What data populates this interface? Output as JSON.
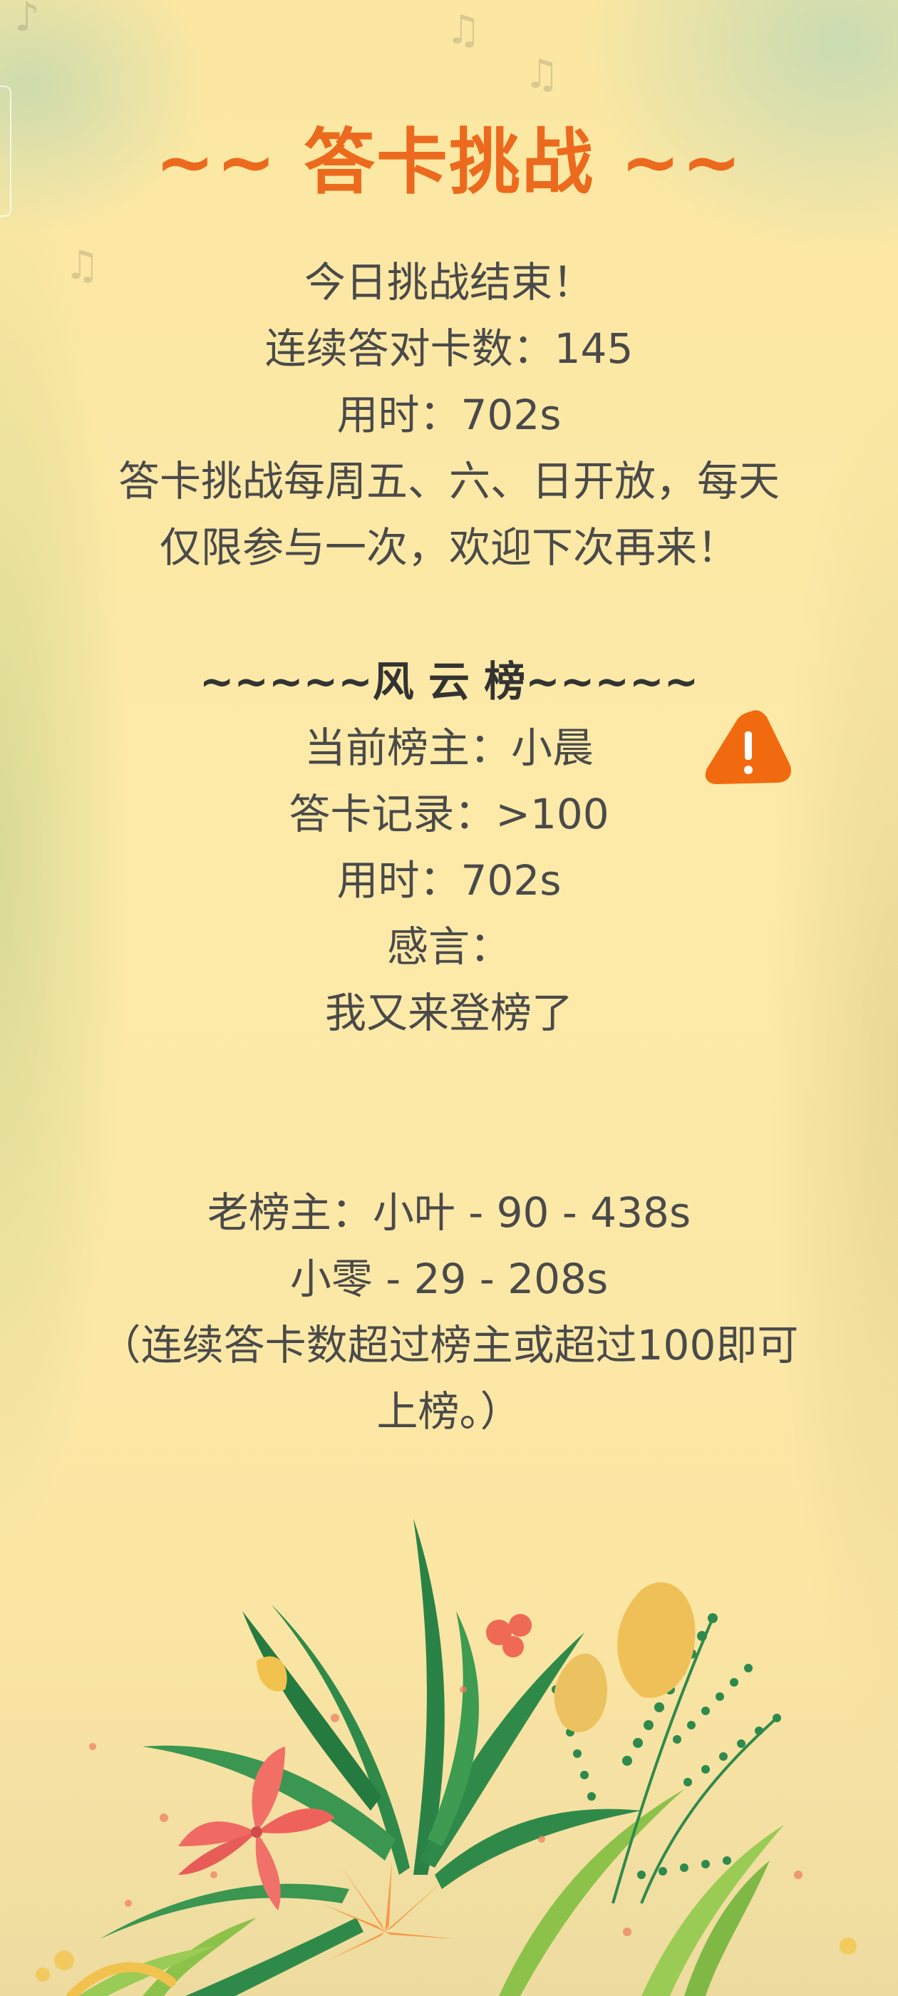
{
  "title": "~~ 答卡挑战 ~~",
  "result": {
    "ended": "今日挑战结束！",
    "streak": "连续答对卡数：145",
    "time": "用时：702s",
    "rule_line1": "答卡挑战每周五、六、日开放，每天",
    "rule_line2": "仅限参与一次，欢迎下次再来！"
  },
  "board": {
    "heading": "~~~~~风 云 榜~~~~~",
    "leader": "当前榜主：小晨",
    "record": "答卡记录：>100",
    "time": "用时：702s",
    "remark_label": "感言：",
    "remark": "我又来登榜了"
  },
  "history": {
    "old_leader": "老榜主：小叶 - 90 - 438s",
    "entry2": "小零 - 29 - 208s",
    "note_line1": "（连续答卡数超过榜主或超过100即可",
    "note_line2": "上榜。）"
  },
  "icons": {
    "warning": "warning-icon",
    "music": "music-note-icon"
  },
  "colors": {
    "title": "#ec6a1e",
    "text": "#4a4a4a",
    "warning": "#f26a10",
    "background": "#fbe9a6"
  }
}
